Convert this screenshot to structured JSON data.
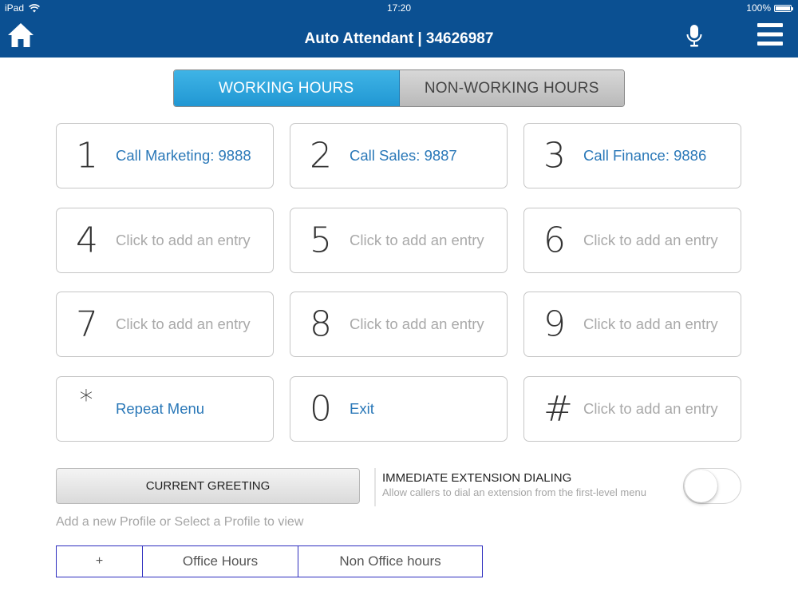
{
  "status_bar": {
    "device": "iPad",
    "time": "17:20",
    "battery": "100%",
    "battery_level": 1.0
  },
  "nav": {
    "title": "Auto Attendant | 34626987",
    "icons": [
      "home-icon",
      "microphone-icon",
      "hamburger-menu-icon"
    ]
  },
  "tabs": {
    "working": "WORKING HOURS",
    "non_working": "NON-WORKING HOURS",
    "selected": "working"
  },
  "colors": {
    "nav_bg": "#0b5092",
    "accent": "#2197d3",
    "assigned_text": "#2a78b8",
    "placeholder_text": "#a9a9a9",
    "profile_border": "#2d2dbe"
  },
  "keypad": [
    {
      "key": "1",
      "label": "Call Marketing: 9888",
      "assigned": true
    },
    {
      "key": "2",
      "label": "Call Sales: 9887",
      "assigned": true
    },
    {
      "key": "3",
      "label": "Call Finance: 9886",
      "assigned": true
    },
    {
      "key": "4",
      "label": "Click to add an entry",
      "assigned": false
    },
    {
      "key": "5",
      "label": "Click to add an entry",
      "assigned": false
    },
    {
      "key": "6",
      "label": "Click to add an entry",
      "assigned": false
    },
    {
      "key": "7",
      "label": "Click to add an entry",
      "assigned": false
    },
    {
      "key": "8",
      "label": "Click to add an entry",
      "assigned": false
    },
    {
      "key": "9",
      "label": "Click to add an entry",
      "assigned": false
    },
    {
      "key": "*",
      "label": "Repeat Menu",
      "assigned": true
    },
    {
      "key": "0",
      "label": "Exit",
      "assigned": true
    },
    {
      "key": "#",
      "label": "Click to add an entry",
      "assigned": false
    }
  ],
  "greeting": {
    "button_label": "CURRENT GREETING"
  },
  "immediate_dialing": {
    "title": "IMMEDIATE EXTENSION DIALING",
    "subtitle": "Allow callers to dial an extension from the first-level menu",
    "enabled": false
  },
  "profiles": {
    "hint": "Add a new Profile or Select a Profile to view",
    "add_label": "+",
    "items": [
      "Office Hours",
      "Non Office hours"
    ]
  }
}
